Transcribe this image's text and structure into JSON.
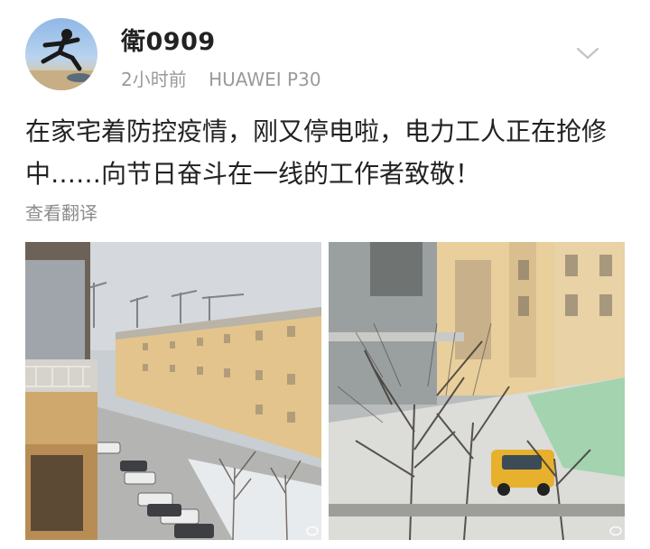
{
  "post": {
    "username": "衛0909",
    "time": "2小时前",
    "device": "HUAWEI P30",
    "text": "在家宅着防控疫情，刚又停电啦，电力工人正在抢修中……向节日奋斗在一线的工作者致敬！",
    "translate_label": "查看翻译"
  },
  "icons": {
    "more": "chevron-down-icon",
    "watermark": "weibo-watermark-icon"
  },
  "colors": {
    "text": "#222222",
    "meta": "#9a9a9a",
    "building": "#e6c98c"
  }
}
